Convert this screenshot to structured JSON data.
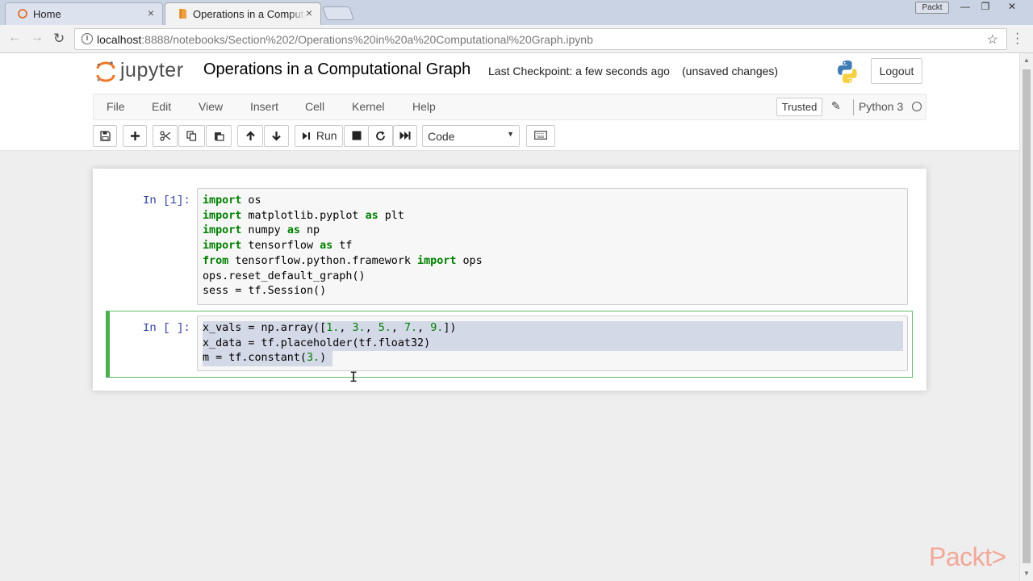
{
  "browser": {
    "tabs": [
      {
        "label": "Home",
        "close": "×"
      },
      {
        "label": "Operations in a Computational Graph",
        "close": "×"
      }
    ],
    "badge": "Packt",
    "window_controls": {
      "minimize": "—",
      "restore": "❐",
      "close": "✕"
    },
    "nav": {
      "back": "←",
      "forward": "→",
      "reload": "↻"
    },
    "url_host": "localhost",
    "url_rest": ":8888/notebooks/Section%202/Operations%20in%20a%20Computational%20Graph.ipynb",
    "star": "☆"
  },
  "jupyter": {
    "logo_text": "jupyter",
    "notebook_title": "Operations in a Computational Graph",
    "checkpoint": "Last Checkpoint: a few seconds ago",
    "unsaved": "(unsaved changes)",
    "logout": "Logout",
    "menu": [
      "File",
      "Edit",
      "View",
      "Insert",
      "Cell",
      "Kernel",
      "Help"
    ],
    "trusted": "Trusted",
    "kernel": "Python 3",
    "run_label": "Run",
    "cell_type": "Code"
  },
  "cells": [
    {
      "prompt": "In [1]:",
      "lines": [
        "import os",
        "import matplotlib.pyplot as plt",
        "import numpy as np",
        "import tensorflow as tf",
        "from tensorflow.python.framework import ops",
        "ops.reset_default_graph()",
        "sess = tf.Session()"
      ]
    },
    {
      "prompt": "In [ ]:",
      "lines": [
        "x_vals = np.array([1., 3., 5., 7., 9.])",
        "x_data = tf.placeholder(tf.float32)",
        "m = tf.constant(3.)"
      ]
    }
  ],
  "watermark": "Packt>",
  "colors": {
    "accent_green": "#4caf50",
    "prompt_blue": "#303f9f",
    "keyword_green": "#008000",
    "selection": "#d4d9e8"
  }
}
